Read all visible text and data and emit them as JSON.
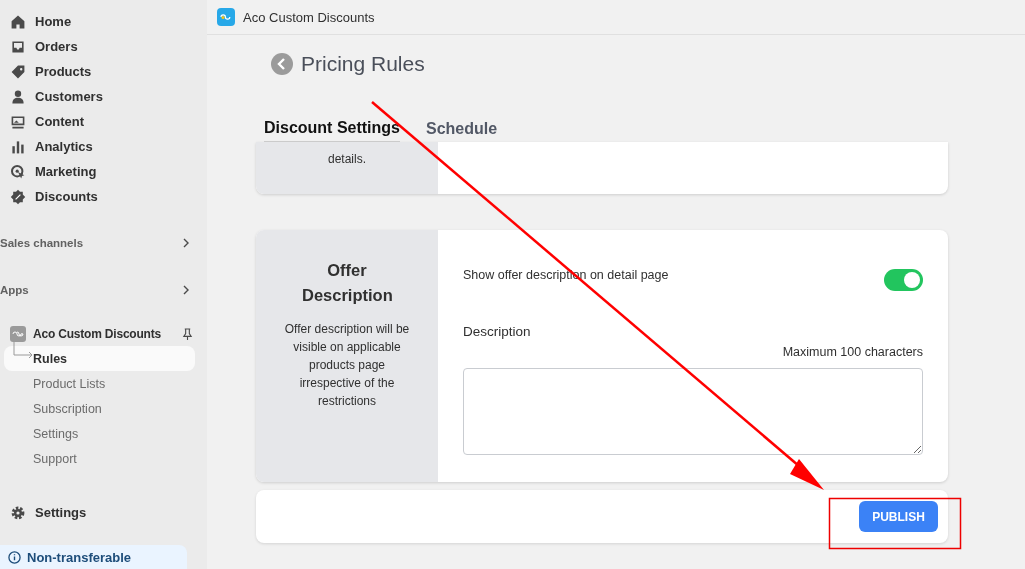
{
  "sidebar": {
    "nav_items": [
      {
        "label": "Home"
      },
      {
        "label": "Orders"
      },
      {
        "label": "Products"
      },
      {
        "label": "Customers"
      },
      {
        "label": "Content"
      },
      {
        "label": "Analytics"
      },
      {
        "label": "Marketing"
      },
      {
        "label": "Discounts"
      }
    ],
    "sections": [
      {
        "label": "Sales channels"
      },
      {
        "label": "Apps"
      }
    ],
    "app": {
      "name": "Aco Custom Discounts",
      "sub_items": [
        {
          "label": "Rules",
          "selected": true
        },
        {
          "label": "Product Lists",
          "selected": false
        },
        {
          "label": "Subscription",
          "selected": false
        },
        {
          "label": "Settings",
          "selected": false
        },
        {
          "label": "Support",
          "selected": false
        }
      ]
    },
    "settings": "Settings",
    "notice": "Non-transferable"
  },
  "topbar": {
    "title": "Aco Custom Discounts"
  },
  "page": {
    "title": "Pricing Rules",
    "tabs": [
      {
        "label": "Discount Settings",
        "selected": true
      },
      {
        "label": "Schedule",
        "selected": false
      }
    ],
    "partial_card": {
      "description_tail": "details."
    },
    "offer_card": {
      "title": "Offer Description",
      "description": "Offer description will be visible on applicable products page irrespective of the restrictions",
      "toggle_label": "Show offer description on detail page",
      "toggle_on": true,
      "field_label": "Description",
      "hint": "Maximum 100 characters"
    },
    "publish_button": "PUBLISH"
  }
}
